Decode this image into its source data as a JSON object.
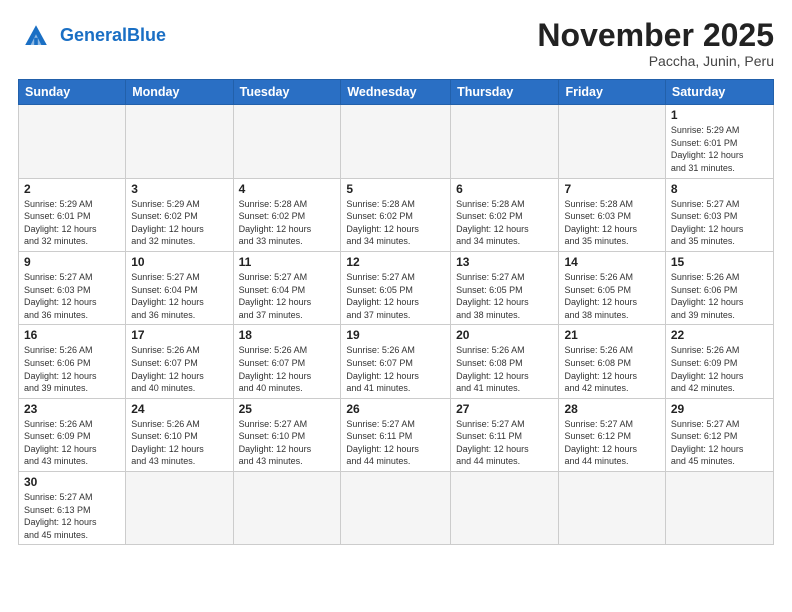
{
  "header": {
    "logo_general": "General",
    "logo_blue": "Blue",
    "month_title": "November 2025",
    "subtitle": "Paccha, Junin, Peru"
  },
  "weekdays": [
    "Sunday",
    "Monday",
    "Tuesday",
    "Wednesday",
    "Thursday",
    "Friday",
    "Saturday"
  ],
  "weeks": [
    [
      {
        "day": "",
        "info": ""
      },
      {
        "day": "",
        "info": ""
      },
      {
        "day": "",
        "info": ""
      },
      {
        "day": "",
        "info": ""
      },
      {
        "day": "",
        "info": ""
      },
      {
        "day": "",
        "info": ""
      },
      {
        "day": "1",
        "info": "Sunrise: 5:29 AM\nSunset: 6:01 PM\nDaylight: 12 hours\nand 31 minutes."
      }
    ],
    [
      {
        "day": "2",
        "info": "Sunrise: 5:29 AM\nSunset: 6:01 PM\nDaylight: 12 hours\nand 32 minutes."
      },
      {
        "day": "3",
        "info": "Sunrise: 5:29 AM\nSunset: 6:02 PM\nDaylight: 12 hours\nand 32 minutes."
      },
      {
        "day": "4",
        "info": "Sunrise: 5:28 AM\nSunset: 6:02 PM\nDaylight: 12 hours\nand 33 minutes."
      },
      {
        "day": "5",
        "info": "Sunrise: 5:28 AM\nSunset: 6:02 PM\nDaylight: 12 hours\nand 34 minutes."
      },
      {
        "day": "6",
        "info": "Sunrise: 5:28 AM\nSunset: 6:02 PM\nDaylight: 12 hours\nand 34 minutes."
      },
      {
        "day": "7",
        "info": "Sunrise: 5:28 AM\nSunset: 6:03 PM\nDaylight: 12 hours\nand 35 minutes."
      },
      {
        "day": "8",
        "info": "Sunrise: 5:27 AM\nSunset: 6:03 PM\nDaylight: 12 hours\nand 35 minutes."
      }
    ],
    [
      {
        "day": "9",
        "info": "Sunrise: 5:27 AM\nSunset: 6:03 PM\nDaylight: 12 hours\nand 36 minutes."
      },
      {
        "day": "10",
        "info": "Sunrise: 5:27 AM\nSunset: 6:04 PM\nDaylight: 12 hours\nand 36 minutes."
      },
      {
        "day": "11",
        "info": "Sunrise: 5:27 AM\nSunset: 6:04 PM\nDaylight: 12 hours\nand 37 minutes."
      },
      {
        "day": "12",
        "info": "Sunrise: 5:27 AM\nSunset: 6:05 PM\nDaylight: 12 hours\nand 37 minutes."
      },
      {
        "day": "13",
        "info": "Sunrise: 5:27 AM\nSunset: 6:05 PM\nDaylight: 12 hours\nand 38 minutes."
      },
      {
        "day": "14",
        "info": "Sunrise: 5:26 AM\nSunset: 6:05 PM\nDaylight: 12 hours\nand 38 minutes."
      },
      {
        "day": "15",
        "info": "Sunrise: 5:26 AM\nSunset: 6:06 PM\nDaylight: 12 hours\nand 39 minutes."
      }
    ],
    [
      {
        "day": "16",
        "info": "Sunrise: 5:26 AM\nSunset: 6:06 PM\nDaylight: 12 hours\nand 39 minutes."
      },
      {
        "day": "17",
        "info": "Sunrise: 5:26 AM\nSunset: 6:07 PM\nDaylight: 12 hours\nand 40 minutes."
      },
      {
        "day": "18",
        "info": "Sunrise: 5:26 AM\nSunset: 6:07 PM\nDaylight: 12 hours\nand 40 minutes."
      },
      {
        "day": "19",
        "info": "Sunrise: 5:26 AM\nSunset: 6:07 PM\nDaylight: 12 hours\nand 41 minutes."
      },
      {
        "day": "20",
        "info": "Sunrise: 5:26 AM\nSunset: 6:08 PM\nDaylight: 12 hours\nand 41 minutes."
      },
      {
        "day": "21",
        "info": "Sunrise: 5:26 AM\nSunset: 6:08 PM\nDaylight: 12 hours\nand 42 minutes."
      },
      {
        "day": "22",
        "info": "Sunrise: 5:26 AM\nSunset: 6:09 PM\nDaylight: 12 hours\nand 42 minutes."
      }
    ],
    [
      {
        "day": "23",
        "info": "Sunrise: 5:26 AM\nSunset: 6:09 PM\nDaylight: 12 hours\nand 43 minutes."
      },
      {
        "day": "24",
        "info": "Sunrise: 5:26 AM\nSunset: 6:10 PM\nDaylight: 12 hours\nand 43 minutes."
      },
      {
        "day": "25",
        "info": "Sunrise: 5:27 AM\nSunset: 6:10 PM\nDaylight: 12 hours\nand 43 minutes."
      },
      {
        "day": "26",
        "info": "Sunrise: 5:27 AM\nSunset: 6:11 PM\nDaylight: 12 hours\nand 44 minutes."
      },
      {
        "day": "27",
        "info": "Sunrise: 5:27 AM\nSunset: 6:11 PM\nDaylight: 12 hours\nand 44 minutes."
      },
      {
        "day": "28",
        "info": "Sunrise: 5:27 AM\nSunset: 6:12 PM\nDaylight: 12 hours\nand 44 minutes."
      },
      {
        "day": "29",
        "info": "Sunrise: 5:27 AM\nSunset: 6:12 PM\nDaylight: 12 hours\nand 45 minutes."
      }
    ],
    [
      {
        "day": "30",
        "info": "Sunrise: 5:27 AM\nSunset: 6:13 PM\nDaylight: 12 hours\nand 45 minutes."
      },
      {
        "day": "",
        "info": ""
      },
      {
        "day": "",
        "info": ""
      },
      {
        "day": "",
        "info": ""
      },
      {
        "day": "",
        "info": ""
      },
      {
        "day": "",
        "info": ""
      },
      {
        "day": "",
        "info": ""
      }
    ]
  ]
}
